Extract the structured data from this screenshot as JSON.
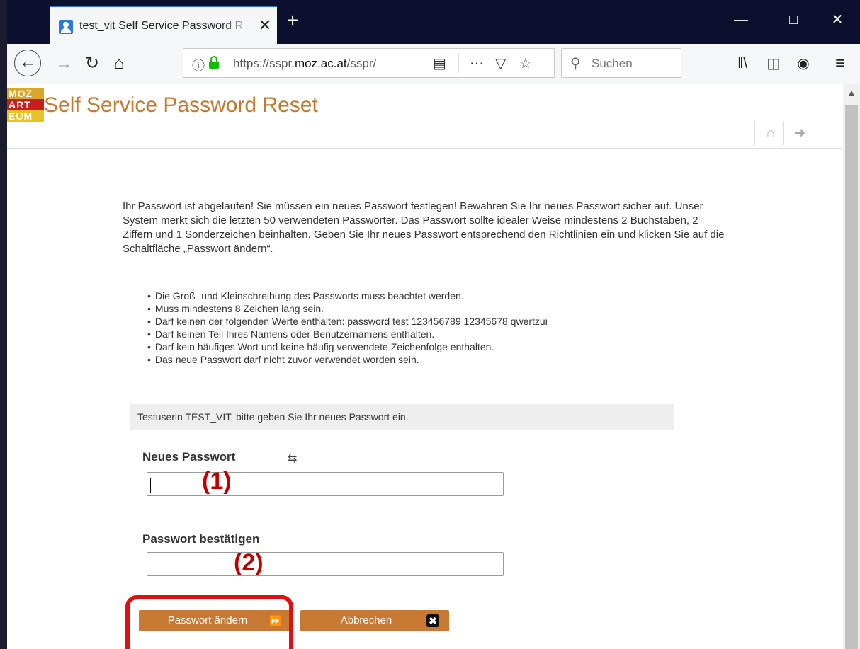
{
  "browser": {
    "tab_title": "test_vit Self Service Password R",
    "tab_close": "✕",
    "new_tab": "+",
    "url_prefix": "https://sspr.",
    "url_domain": "moz.ac.at",
    "url_suffix": "/sspr/",
    "search_placeholder": "Suchen"
  },
  "header": {
    "logo_lines": [
      "MOZ",
      "ART",
      "EUM"
    ],
    "title": "Self Service Password Reset"
  },
  "main": {
    "intro": "Ihr Passwort ist abgelaufen! Sie müssen ein neues Passwort festlegen! Bewahren Sie Ihr neues Passwort sicher auf. Unser System merkt sich die letzten 50 verwendeten Passwörter. Das Passwort sollte idealer Weise mindestens 2 Buchstaben, 2 Ziffern und 1 Sonderzeichen beinhalten. Geben Sie Ihr neues Passwort entsprechend den Richtlinien ein und klicken Sie auf die Schaltfläche „Passwort ändern“.",
    "rules": [
      "Die Groß- und Kleinschreibung des Passworts muss beachtet werden.",
      "Muss mindestens 8 Zeichen lang sein.",
      "Darf keinen der folgenden Werte enthalten: password test 123456789 12345678 qwertzui",
      "Darf keinen Teil Ihres Namens oder Benutzernamens enthalten.",
      "Darf kein häufiges Wort und keine häufig verwendete Zeichenfolge enthalten.",
      "Das neue Passwort darf nicht zuvor verwendet worden sein."
    ],
    "greeting": "Testuserin TEST_VIT, bitte geben Sie Ihr neues Passwort ein.",
    "new_password_label": "Neues Passwort",
    "new_password_value": "",
    "confirm_label": "Passwort bestätigen",
    "confirm_value": "",
    "annotation_1": "(1)",
    "annotation_2": "(2)",
    "change_button": "Passwort ändern",
    "cancel_button": "Abbrechen"
  }
}
